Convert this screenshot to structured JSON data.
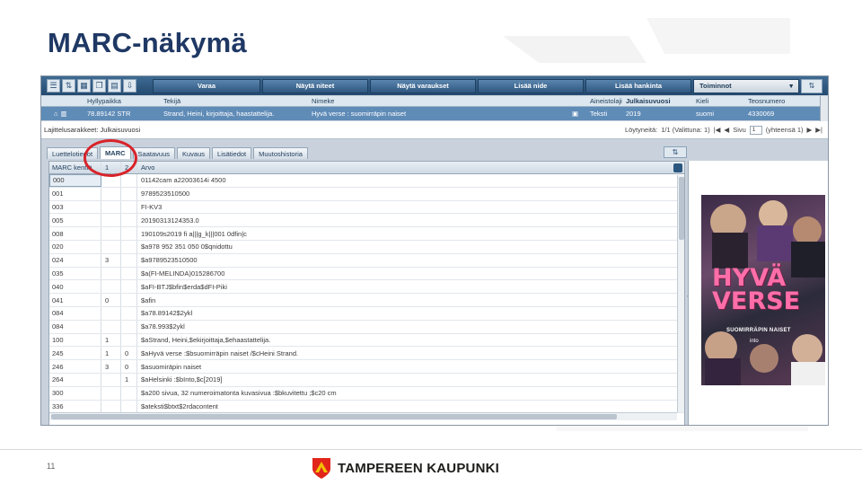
{
  "slide": {
    "title": "MARC-näkymä",
    "page_number": "11",
    "logo_text": "TAMPEREEN KAUPUNKI"
  },
  "toolbar": {
    "buttons": [
      "Varaa",
      "Näytä niteet",
      "Näytä varaukset",
      "Lisää nide",
      "Lisää hankinta"
    ],
    "menu_label": "Toiminnot"
  },
  "results": {
    "headers": [
      "Hyllypaikka",
      "Tekijä",
      "Nimeke",
      "Aineistolaji",
      "Julkaisuvuosi",
      "Kieli",
      "Teosnumero"
    ],
    "row": [
      "78.89142 STR",
      "Strand, Heini, kirjoittaja, haastattelija.",
      "Hyvä verse : suomirräpin naiset",
      "Teksti",
      "2019",
      "suomi",
      "4330069"
    ]
  },
  "infobar": {
    "sort_text": "Lajittelusarakkeet: Julkaisuvuosi",
    "found_label": "Löytyneitä:",
    "found_value": "1/1 (Valittuna: 1)",
    "page_label": "Sivu",
    "page_value": "1",
    "page_total": "(yhteensä 1)"
  },
  "tabs": [
    "Luettelotiedot",
    "MARC",
    "Saatavuus",
    "Kuvaus",
    "Lisätiedot",
    "Muutoshistoria"
  ],
  "marc": {
    "headers": [
      "MARC kenttä",
      "1",
      "2",
      "Arvo"
    ],
    "rows": [
      [
        "000",
        "",
        "",
        "01142cam a22003614i 4500"
      ],
      [
        "001",
        "",
        "",
        "9789523510500"
      ],
      [
        "003",
        "",
        "",
        "FI-KV3"
      ],
      [
        "005",
        "",
        "",
        "20190313124353.0"
      ],
      [
        "008",
        "",
        "",
        "190109s2019    fi a|||g_k|||001 0dfin|c"
      ],
      [
        "020",
        "",
        "",
        "$a978 952 351 050 0$qnidottu"
      ],
      [
        "024",
        "3",
        "",
        "$a9789523510500"
      ],
      [
        "035",
        "",
        "",
        "$a(FI-MELINDA)015286700"
      ],
      [
        "040",
        "",
        "",
        "$aFI-BTJ$bfin$erda$dFI-Piki"
      ],
      [
        "041",
        "0",
        "",
        "$afin"
      ],
      [
        "084",
        "",
        "",
        "$a78.89142$2ykl"
      ],
      [
        "084",
        "",
        "",
        "$a78.993$2ykl"
      ],
      [
        "100",
        "1",
        "",
        "$aStrand, Heini,$ekirjoittaja,$ehaastattelija."
      ],
      [
        "245",
        "1",
        "0",
        "$aHyvä verse :$bsuomirräpin naiset /$cHeini Strand."
      ],
      [
        "246",
        "3",
        "0",
        "$asuomiräpin naiset"
      ],
      [
        "264",
        "",
        "1",
        "$aHelsinki :$bInto,$c[2019]"
      ],
      [
        "300",
        "",
        "",
        "$a200 sivua, 32 numeroimatonta kuvasivua :$bkuvitettu ;$c20 cm"
      ],
      [
        "336",
        "",
        "",
        "$ateksti$btxt$2rdacontent"
      ]
    ]
  },
  "cover": {
    "title_line1": "HYVÄ",
    "title_line2": "VERSE",
    "subtitle": "SUOMIRRÄPIN NAISET",
    "publisher": "into"
  },
  "icons": [
    "list-icon",
    "sort-icon",
    "grid-icon",
    "copy-icon",
    "book-icon",
    "home-icon",
    "text-icon",
    "nav-first-icon",
    "nav-prev-icon",
    "nav-next-icon",
    "nav-last-icon"
  ],
  "colors": {
    "title": "#1f3864",
    "toolbar": "#2f5781",
    "selected_row": "#5f8bb7",
    "highlight": "#d8232a"
  }
}
